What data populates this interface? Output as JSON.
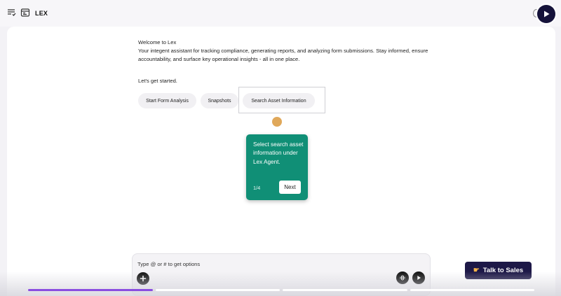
{
  "app": {
    "title": "LEX"
  },
  "welcome": {
    "title": "Welcome to Lex",
    "description": "Your integent assistant for tracking compliance, generating reports, and analyzing form submissions. Stay informed, ensure accountability, and surface key operational insights - all in one place.",
    "prompt": "Let's get started."
  },
  "actions": [
    {
      "label": "Start Form Analysis"
    },
    {
      "label": "Snapshots"
    },
    {
      "label": "Search Asset Information"
    }
  ],
  "tour": {
    "text": "Select search asset information under Lex Agent.",
    "step": "1/4",
    "next_label": "Next",
    "color": "#108f76",
    "highlighted_action": "Search Asset Information"
  },
  "chat": {
    "placeholder": "Type @ or # to get options",
    "value": "",
    "icons": [
      "plus-icon",
      "voice-wave-icon",
      "send-play-icon"
    ]
  },
  "cta": {
    "label": "Talk to Sales",
    "icon": "pointing-hand-icon",
    "color": "#1d1847"
  },
  "playback": {
    "segments": 4,
    "current_segment": 1,
    "segment_progress": [
      1.0,
      0.0,
      0.0,
      0.0
    ],
    "accent": "#8a4de0"
  }
}
